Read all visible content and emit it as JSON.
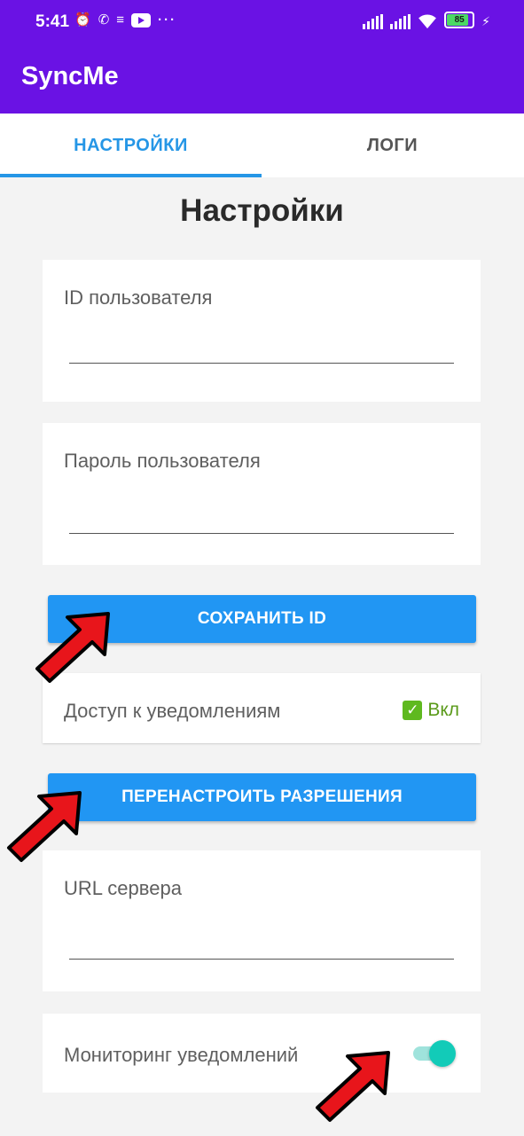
{
  "status_bar": {
    "time": "5:41",
    "battery": "85",
    "left_icons": [
      "muted-alarm-icon",
      "whatsapp-icon",
      "layers-icon",
      "youtube-icon",
      "more-dots-icon"
    ],
    "right_icons": [
      "signal-icon",
      "signal-icon",
      "wifi-icon",
      "battery-icon",
      "charging-icon"
    ]
  },
  "app": {
    "title": "SyncMe",
    "accent": "#6a12e4"
  },
  "tabs": [
    {
      "label": "НАСТРОЙКИ",
      "active": true
    },
    {
      "label": "ЛОГИ",
      "active": false
    }
  ],
  "page_title": "Настройки",
  "user_id": {
    "label": "ID пользователя",
    "value": ""
  },
  "password": {
    "label": "Пароль пользователя",
    "value": ""
  },
  "save_button": {
    "label": "СОХРАНИТЬ ID"
  },
  "notification_access": {
    "label": "Доступ к уведомлениям",
    "status": "Вкл",
    "status_icon": "check-mark-icon"
  },
  "reconfigure_button": {
    "label": "ПЕРЕНАСТРОИТЬ РАЗРЕШЕНИЯ"
  },
  "server_url": {
    "label": "URL сервера",
    "value": ""
  },
  "monitoring": {
    "label": "Мониторинг уведомлений",
    "enabled": true
  },
  "colors": {
    "primary_button": "#2196f3",
    "tab_active": "#2596e6",
    "toggle_on": "#12cbb8",
    "arrow": "#e8151b"
  }
}
